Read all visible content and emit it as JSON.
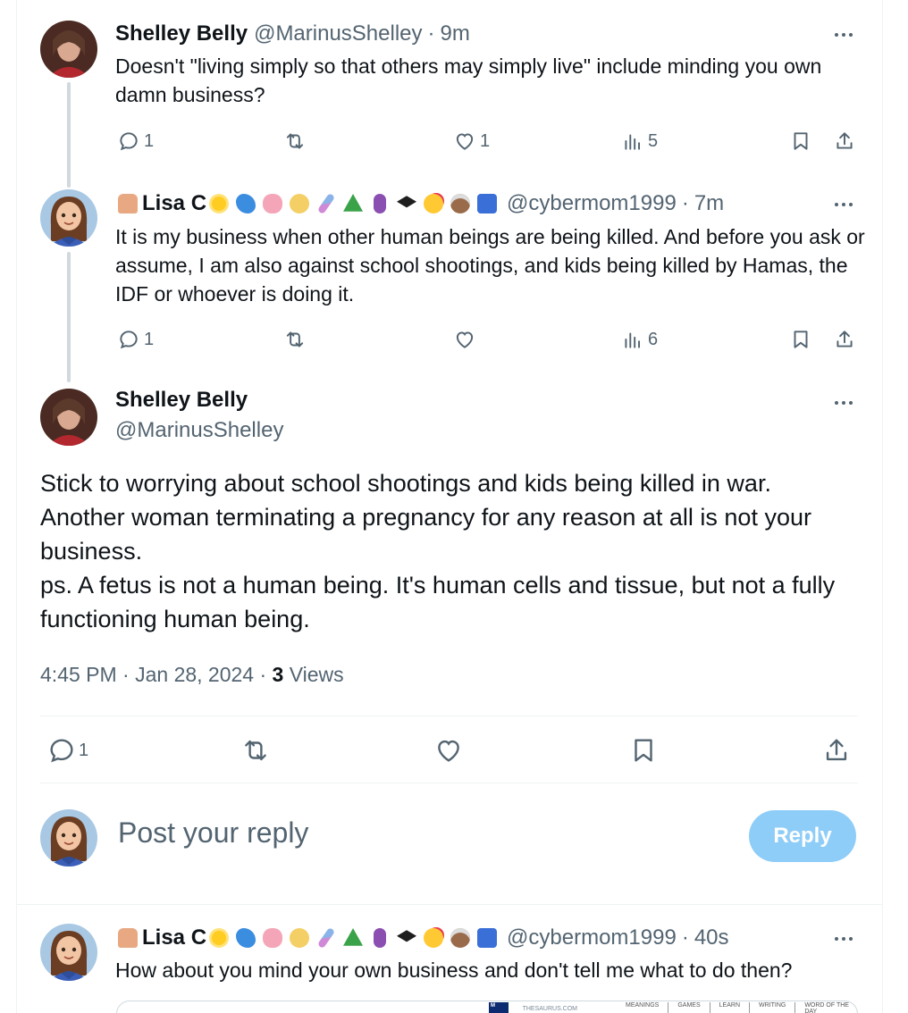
{
  "replies": [
    {
      "name": "Shelley Belly",
      "handle": "@MarinusShelley",
      "time": "9m",
      "text": "Doesn't \"living simply so that others may simply live\" include minding you own damn business?",
      "reply_count": "1",
      "retweet_count": "",
      "like_count": "1",
      "view_count": "5"
    },
    {
      "name": "Lisa C",
      "handle": "@cybermom1999",
      "time": "7m",
      "text": "It is my business when other human beings are being killed. And before you ask or assume, I am also against school shootings, and kids being killed by Hamas, the IDF or whoever is doing it.",
      "reply_count": "1",
      "retweet_count": "",
      "like_count": "",
      "view_count": "6"
    }
  ],
  "name_emojis": [
    "woman-technologist",
    "sun",
    "butterfly",
    "brain",
    "blond-person",
    "dna",
    "recycling",
    "pregnant-person",
    "graduation-cap",
    "smiling-face-with-hearts",
    "older-person",
    "wheelchair-symbol"
  ],
  "main_tweet": {
    "name": "Shelley Belly",
    "handle": "@MarinusShelley",
    "paragraphs": [
      "Stick to worrying about school shootings and kids being killed in war.",
      "Another woman terminating a pregnancy for any reason at all is not your business.",
      "ps. A fetus is not a human being. It's human cells and tissue, but not a fully functioning human being."
    ],
    "timestamp": "4:45 PM · Jan 28, 2024 · ",
    "views_count": "3",
    "views_label": " Views",
    "reply_count": "1"
  },
  "composer": {
    "placeholder": "Post your reply",
    "button_label": "Reply"
  },
  "latest_reply": {
    "name": "Lisa C",
    "handle": "@cybermom1999",
    "time": "40s",
    "text": "How about you mind your own business and don't tell me what to do then?",
    "card": {
      "logo": "M",
      "site": "THESAURUS.COM",
      "nav": [
        "MEANINGS",
        "GAMES",
        "LEARN",
        "WRITING",
        "WORD OF THE DAY"
      ]
    }
  },
  "colors": {
    "text": "#0f1419",
    "secondary": "#536471",
    "thread_line": "#cfd9de",
    "reply_button": "#8ecdf8"
  }
}
